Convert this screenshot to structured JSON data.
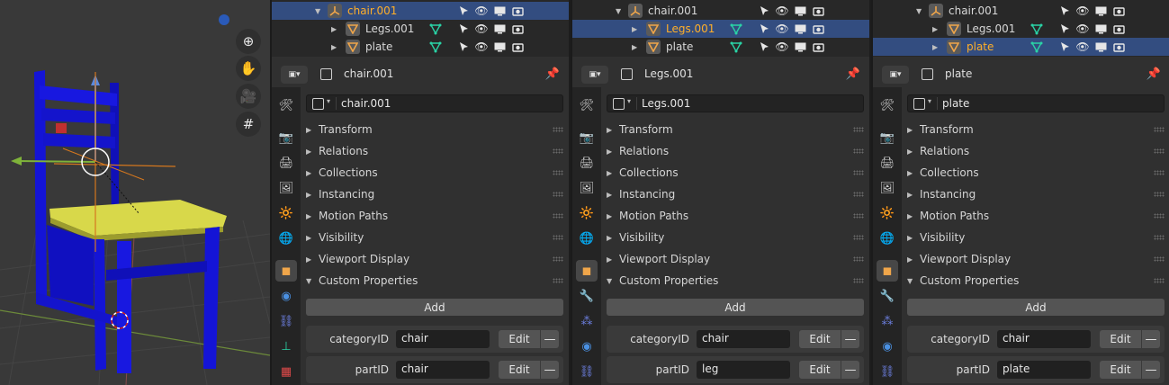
{
  "viewport": {
    "nav_icons": [
      "zoom-icon",
      "pan-hand-icon",
      "camera-icon",
      "grid-icon"
    ]
  },
  "panels": [
    {
      "outliner": {
        "rows": [
          {
            "label": "chair.001",
            "active": true
          },
          {
            "label": "Legs.001",
            "active": false
          },
          {
            "label": "plate",
            "active": false
          }
        ]
      },
      "header_title": "chair.001",
      "object_name": "chair.001",
      "sections": [
        "Transform",
        "Relations",
        "Collections",
        "Instancing",
        "Motion Paths",
        "Visibility",
        "Viewport Display",
        "Custom Properties"
      ],
      "add_label": "Add",
      "props": [
        {
          "label": "categoryID",
          "value": "chair",
          "edit": "Edit",
          "del": "—"
        },
        {
          "label": "partID",
          "value": "chair",
          "edit": "Edit",
          "del": "—"
        }
      ]
    },
    {
      "outliner": {
        "rows": [
          {
            "label": "chair.001",
            "active": false
          },
          {
            "label": "Legs.001",
            "active": true
          },
          {
            "label": "plate",
            "active": false
          }
        ]
      },
      "header_title": "Legs.001",
      "object_name": "Legs.001",
      "sections": [
        "Transform",
        "Relations",
        "Collections",
        "Instancing",
        "Motion Paths",
        "Visibility",
        "Viewport Display",
        "Custom Properties"
      ],
      "add_label": "Add",
      "props": [
        {
          "label": "categoryID",
          "value": "chair",
          "edit": "Edit",
          "del": "—"
        },
        {
          "label": "partID",
          "value": "leg",
          "edit": "Edit",
          "del": "—"
        }
      ]
    },
    {
      "outliner": {
        "rows": [
          {
            "label": "chair.001",
            "active": false
          },
          {
            "label": "Legs.001",
            "active": false
          },
          {
            "label": "plate",
            "active": true
          }
        ]
      },
      "header_title": "plate",
      "object_name": "plate",
      "sections": [
        "Transform",
        "Relations",
        "Collections",
        "Instancing",
        "Motion Paths",
        "Visibility",
        "Viewport Display",
        "Custom Properties"
      ],
      "add_label": "Add",
      "props": [
        {
          "label": "categoryID",
          "value": "chair",
          "edit": "Edit",
          "del": "—"
        },
        {
          "label": "partID",
          "value": "plate",
          "edit": "Edit",
          "del": "—"
        }
      ]
    }
  ],
  "colors": {
    "selected_row": "#334d80",
    "active_text": "#ffaf29",
    "mesh_icon": "#f0a64a",
    "empty_icon": "#f0a64a",
    "vertex_icon": "#2ad3a6",
    "chair_blue": "#1414d6",
    "seat_yellow": "#d8d84a"
  }
}
